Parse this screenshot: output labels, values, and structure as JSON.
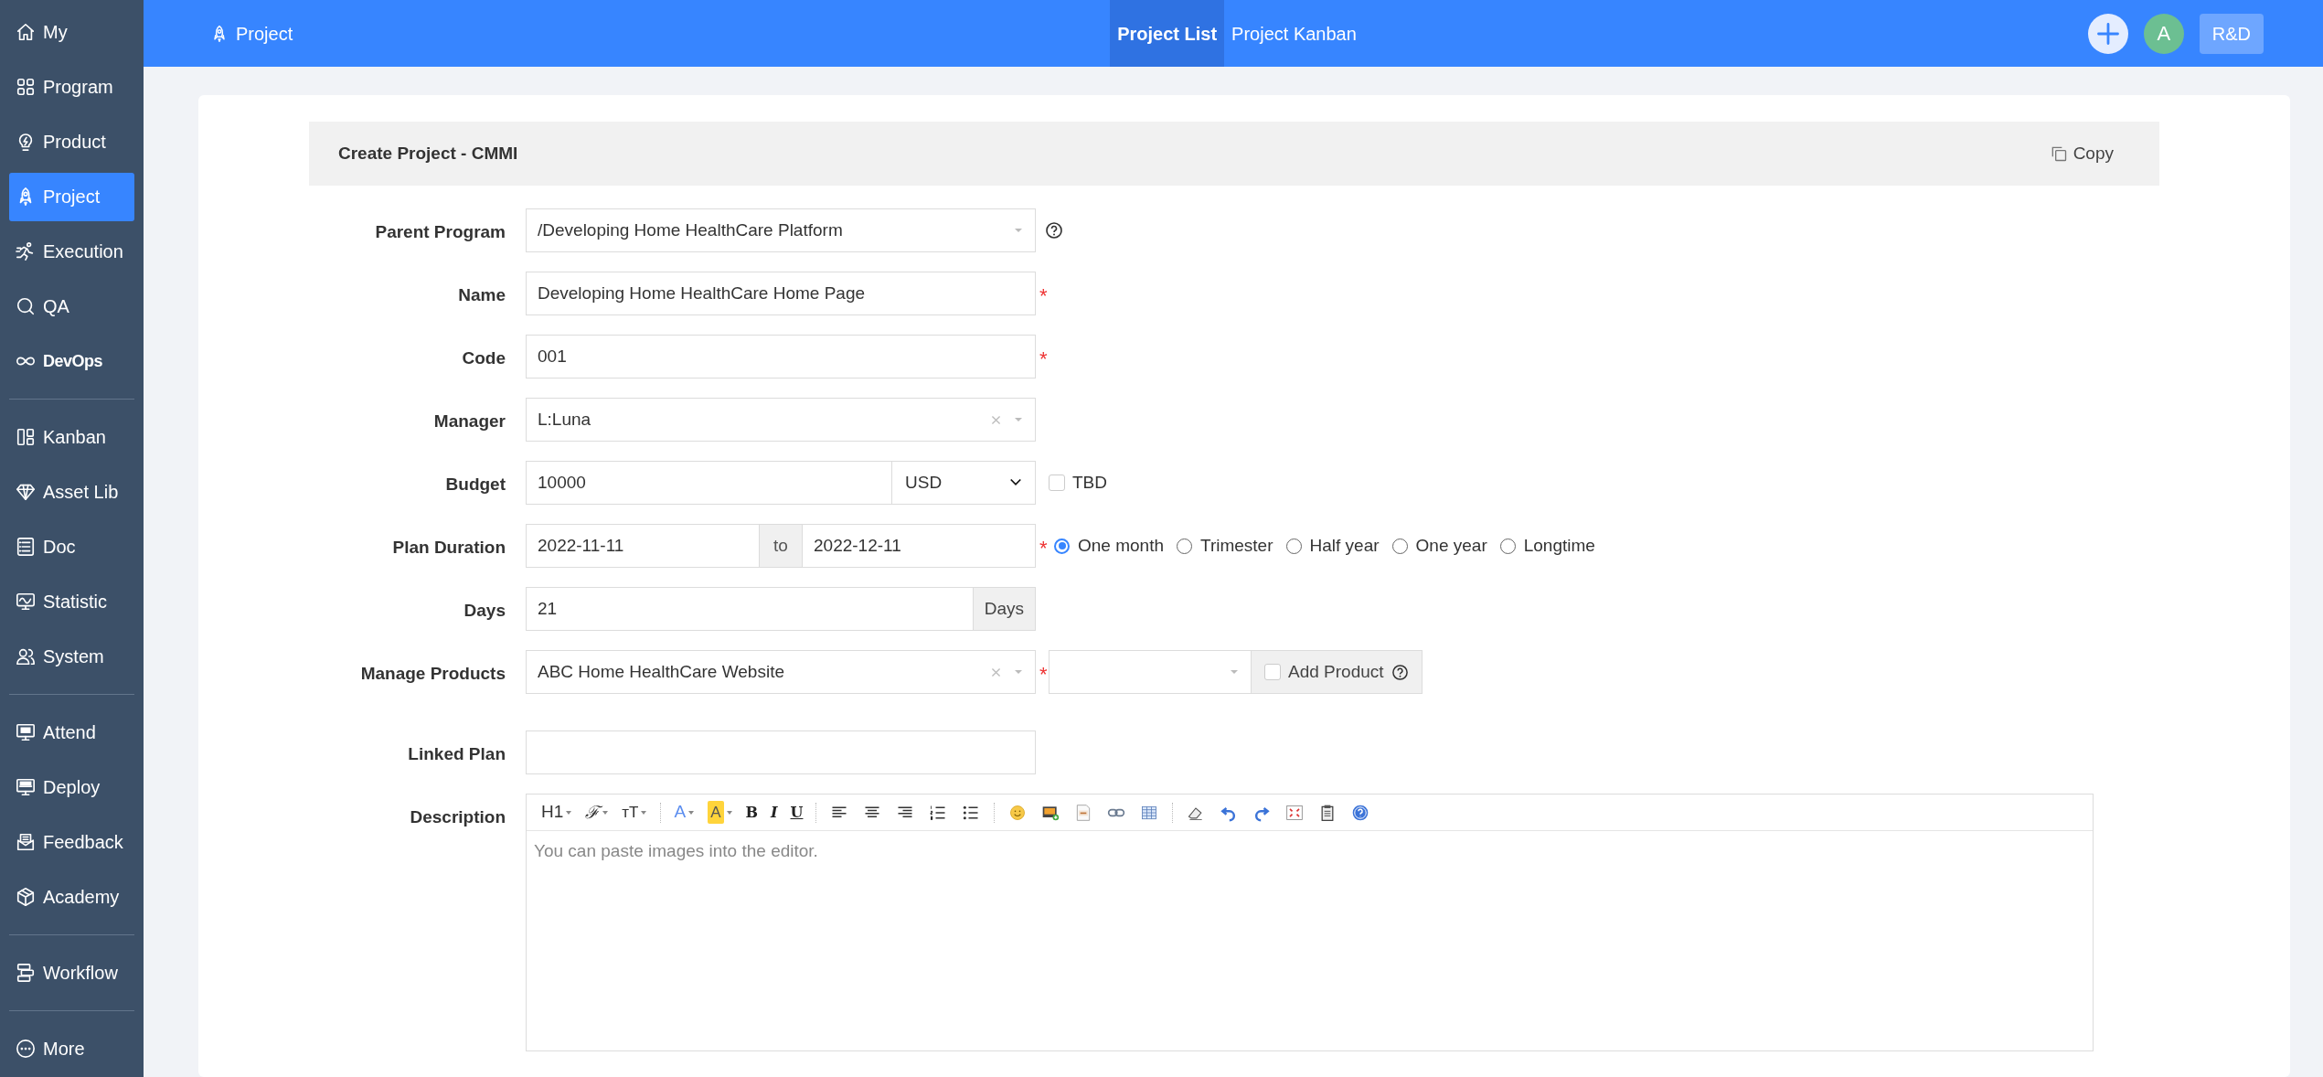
{
  "sidebar": {
    "groups": [
      [
        {
          "label": "My",
          "selected": false
        },
        {
          "label": "Program",
          "selected": false
        },
        {
          "label": "Product",
          "selected": false
        },
        {
          "label": "Project",
          "selected": true
        },
        {
          "label": "Execution",
          "selected": false
        },
        {
          "label": "QA",
          "selected": false
        },
        {
          "label": "DevOps",
          "selected": false
        }
      ],
      [
        {
          "label": "Kanban",
          "selected": false
        },
        {
          "label": "Asset Lib",
          "selected": false
        },
        {
          "label": "Doc",
          "selected": false
        },
        {
          "label": "Statistic",
          "selected": false
        },
        {
          "label": "System",
          "selected": false
        }
      ],
      [
        {
          "label": "Attend",
          "selected": false
        },
        {
          "label": "Deploy",
          "selected": false
        },
        {
          "label": "Feedback",
          "selected": false
        },
        {
          "label": "Academy",
          "selected": false
        }
      ],
      [
        {
          "label": "Workflow",
          "selected": false
        }
      ],
      [
        {
          "label": "More",
          "selected": false
        }
      ]
    ]
  },
  "topbar": {
    "module": "Project",
    "tabs": [
      {
        "label": "Project List",
        "selected": true
      },
      {
        "label": "Project Kanban",
        "selected": false
      }
    ],
    "avatar": "A",
    "team": "R&D"
  },
  "panel": {
    "title": "Create Project - CMMI",
    "copy": "Copy"
  },
  "fields": [
    {
      "kind": "select",
      "label": "Parent Program",
      "value": "/Developing Home HealthCare Platform",
      "help": true
    },
    {
      "kind": "text",
      "label": "Name",
      "value": "Developing Home HealthCare Home Page",
      "required_mark": "*"
    },
    {
      "kind": "text",
      "label": "Code",
      "value": "001",
      "required_mark": "*"
    },
    {
      "kind": "select",
      "label": "Manager",
      "value": "L:Luna",
      "clearable": true
    },
    {
      "kind": "budget",
      "label": "Budget",
      "value": "10000",
      "currency": "USD",
      "tbd": {
        "label": "TBD",
        "checked": false
      }
    },
    {
      "kind": "duration",
      "label": "Plan Duration",
      "begin": "2022-11-11",
      "to": "to",
      "end": "2022-12-11",
      "required_mark": "*",
      "options": [
        {
          "label": "One month",
          "selected": true
        },
        {
          "label": "Trimester",
          "selected": false
        },
        {
          "label": "Half year",
          "selected": false
        },
        {
          "label": "One year",
          "selected": false
        },
        {
          "label": "Longtime",
          "selected": false
        }
      ]
    },
    {
      "kind": "days",
      "label": "Days",
      "value": "21",
      "unit": "Days"
    },
    {
      "kind": "products",
      "label": "Manage Products",
      "value": "ABC Home HealthCare Website",
      "clearable": true,
      "required_mark": "*",
      "add_product": {
        "label": "Add Product",
        "checked": false
      }
    },
    {
      "kind": "text",
      "label": "Linked Plan"
    },
    {
      "kind": "editor",
      "label": "Description",
      "placeholder": "You can paste images into the editor.",
      "toolbar": [
        [
          {
            "kind": "heading",
            "label": "H1"
          },
          {
            "kind": "font",
            "label": "ℱ"
          },
          {
            "kind": "size",
            "label": "ᴛT"
          }
        ],
        [
          {
            "kind": "font_color",
            "label": "A"
          },
          {
            "kind": "highlight",
            "label": "A"
          },
          {
            "kind": "bold",
            "label": "B"
          },
          {
            "kind": "italic",
            "label": "I"
          },
          {
            "kind": "underline",
            "label": "U"
          }
        ]
      ]
    }
  ]
}
